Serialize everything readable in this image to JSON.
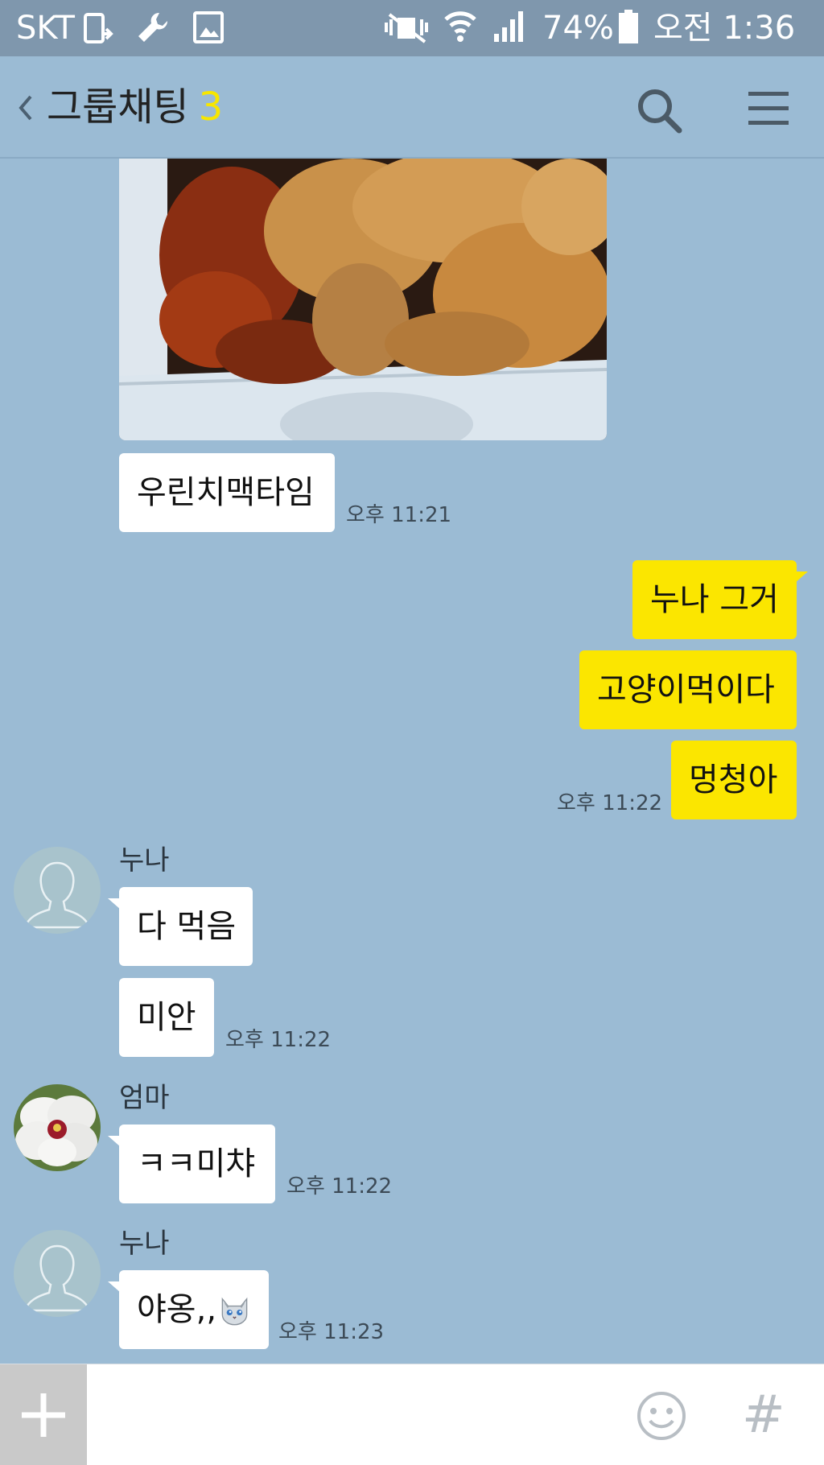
{
  "status_bar": {
    "carrier": "SKT",
    "battery": "74%",
    "time": "오전 1:36"
  },
  "header": {
    "title": "그룹채팅",
    "member_count": "3"
  },
  "messages": {
    "m1": {
      "text": "우린치맥타임",
      "time": "오후 11:21"
    },
    "m2": {
      "text": "누나 그거"
    },
    "m3": {
      "text": "고양이먹이다"
    },
    "m4": {
      "text": "멍청아",
      "time": "오후 11:22"
    },
    "g1": {
      "sender": "누나",
      "line1": "다 먹음",
      "line2": "미안",
      "time": "오후 11:22"
    },
    "g2": {
      "sender": "엄마",
      "text": "ㅋㅋ미챠",
      "time": "오후 11:22"
    },
    "g3": {
      "sender": "누나",
      "text": "야옹,,",
      "time": "오후 11:23"
    }
  },
  "input_bar": {
    "placeholder": ""
  },
  "colors": {
    "chat_bg": "#9bbbd4",
    "my_bubble": "#fbe600",
    "other_bubble": "#ffffff",
    "accent_count": "#f7e600"
  },
  "icons": [
    "back-chevron-icon",
    "search-icon",
    "menu-icon",
    "plus-icon",
    "emoji-icon",
    "hashtag-icon",
    "cat-emoji-icon"
  ]
}
